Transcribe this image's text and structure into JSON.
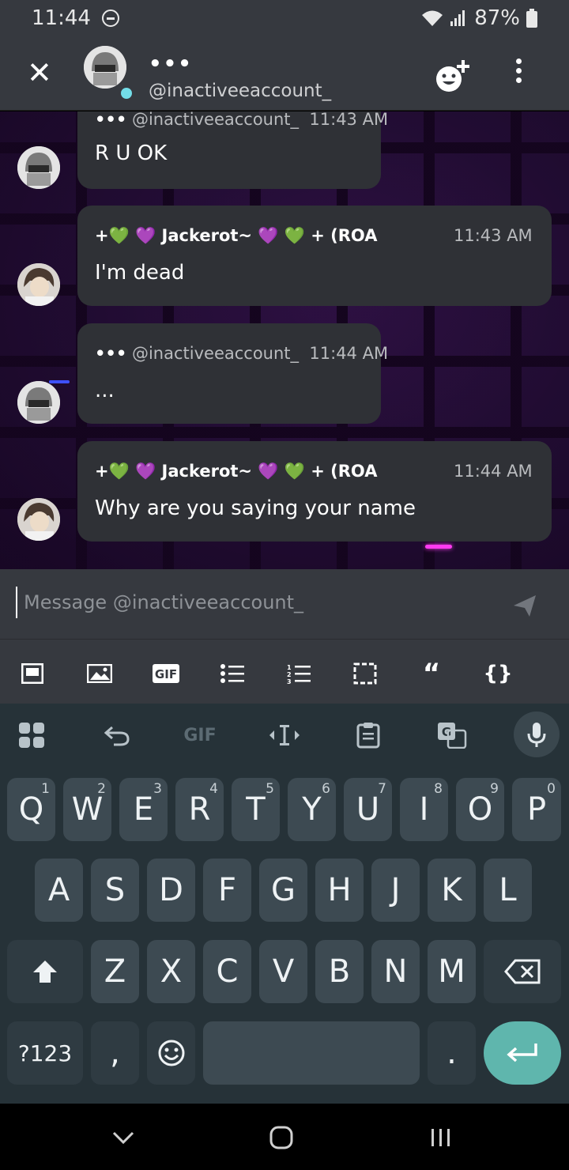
{
  "status_bar": {
    "time": "11:44",
    "battery": "87%"
  },
  "header": {
    "name": "•••",
    "handle": "@inactiveeaccount_"
  },
  "messages": [
    {
      "author": "•••",
      "handle": "@inactiveeaccount_",
      "time": "11:43 AM",
      "text": "R U OK"
    },
    {
      "author": "+💚 💜 Jackerot~ 💜 💚 + (ROA",
      "time": "11:43 AM",
      "text": "I'm dead"
    },
    {
      "author": "•••",
      "handle": "@inactiveeaccount_",
      "time": "11:44 AM",
      "text": "..."
    },
    {
      "author": "+💚 💜 Jackerot~ 💜 💚 + (ROA",
      "time": "11:44 AM",
      "text": "Why are you saying your name"
    }
  ],
  "composer": {
    "placeholder": "Message @inactiveeaccount_",
    "format_buttons": [
      "spoiler-icon",
      "image-icon",
      "GIF",
      "bullet-list-icon",
      "numbered-list-icon",
      "selection-icon",
      "“",
      "{}"
    ]
  },
  "keyboard": {
    "toolbar": {
      "gif": "GIF"
    },
    "row1": [
      [
        "Q",
        "1"
      ],
      [
        "W",
        "2"
      ],
      [
        "E",
        "3"
      ],
      [
        "R",
        "4"
      ],
      [
        "T",
        "5"
      ],
      [
        "Y",
        "6"
      ],
      [
        "U",
        "7"
      ],
      [
        "I",
        "8"
      ],
      [
        "O",
        "9"
      ],
      [
        "P",
        "0"
      ]
    ],
    "row2": [
      "A",
      "S",
      "D",
      "F",
      "G",
      "H",
      "J",
      "K",
      "L"
    ],
    "row3": [
      "Z",
      "X",
      "C",
      "V",
      "B",
      "N",
      "M"
    ],
    "symbols": "?123",
    "comma": ",",
    "period": "."
  },
  "colors": {
    "accent": "#5fb6ad",
    "online": "#73dde8",
    "bubble": "#2f3136",
    "header": "#36393f"
  }
}
